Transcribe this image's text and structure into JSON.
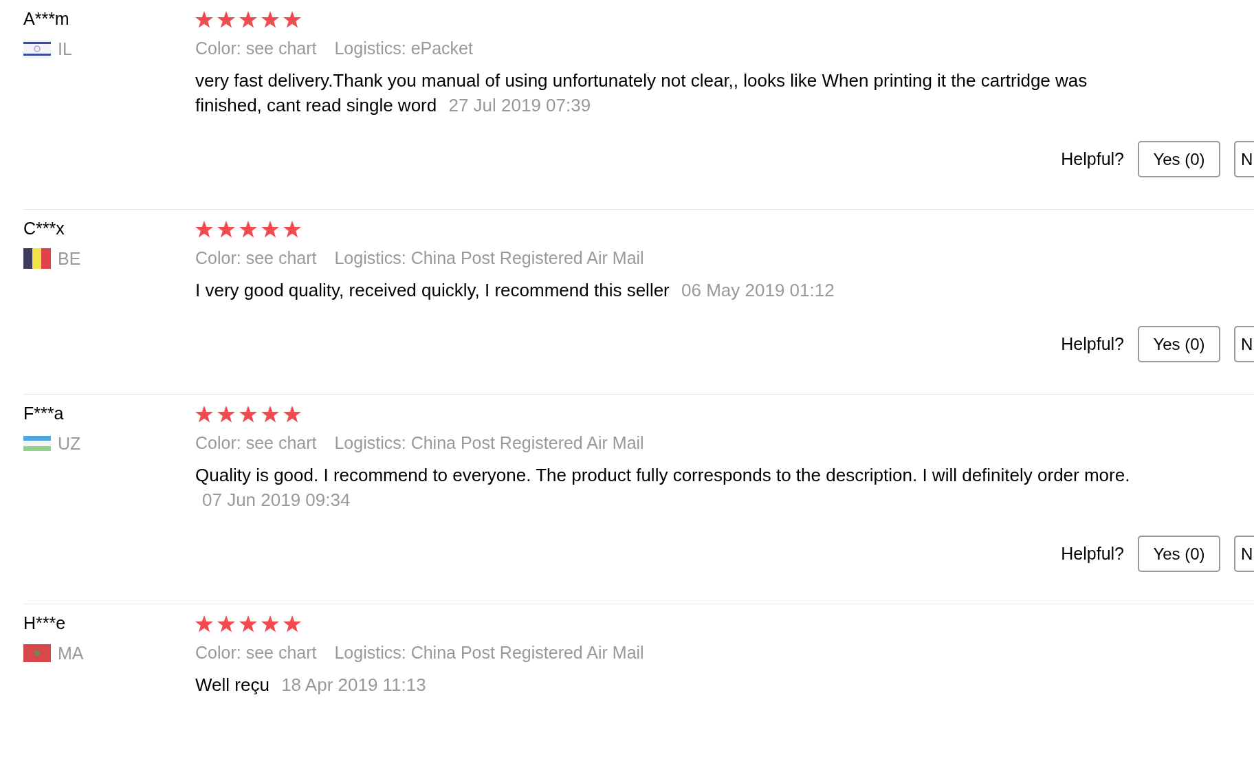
{
  "reviews": [
    {
      "name": "A***m",
      "country": "IL",
      "stars": 5,
      "variant": "Color: see chart",
      "logistics": "Logistics: ePacket",
      "text": "very fast delivery.Thank you manual of using unfortunately not clear,, looks like When printing it the cartridge was finished, cant read single word",
      "date": "27 Jul 2019 07:39",
      "helpful": "Helpful?",
      "yes": "Yes (0)",
      "no": "N"
    },
    {
      "name": "C***x",
      "country": "BE",
      "stars": 5,
      "variant": "Color: see chart",
      "logistics": "Logistics: China Post Registered Air Mail",
      "text": "I very good quality, received quickly, I recommend this seller",
      "date": "06 May 2019 01:12",
      "helpful": "Helpful?",
      "yes": "Yes (0)",
      "no": "N"
    },
    {
      "name": "F***a",
      "country": "UZ",
      "stars": 5,
      "variant": "Color: see chart",
      "logistics": "Logistics: China Post Registered Air Mail",
      "text": "Quality is good. I recommend to everyone. The product fully corresponds to the description. I will definitely order more.",
      "date": "07 Jun 2019 09:34",
      "helpful": "Helpful?",
      "yes": "Yes (0)",
      "no": "N"
    },
    {
      "name": "H***e",
      "country": "MA",
      "stars": 5,
      "variant": "Color: see chart",
      "logistics": "Logistics: China Post Registered Air Mail",
      "text": "Well reçu",
      "date": "18 Apr 2019 11:13"
    }
  ]
}
